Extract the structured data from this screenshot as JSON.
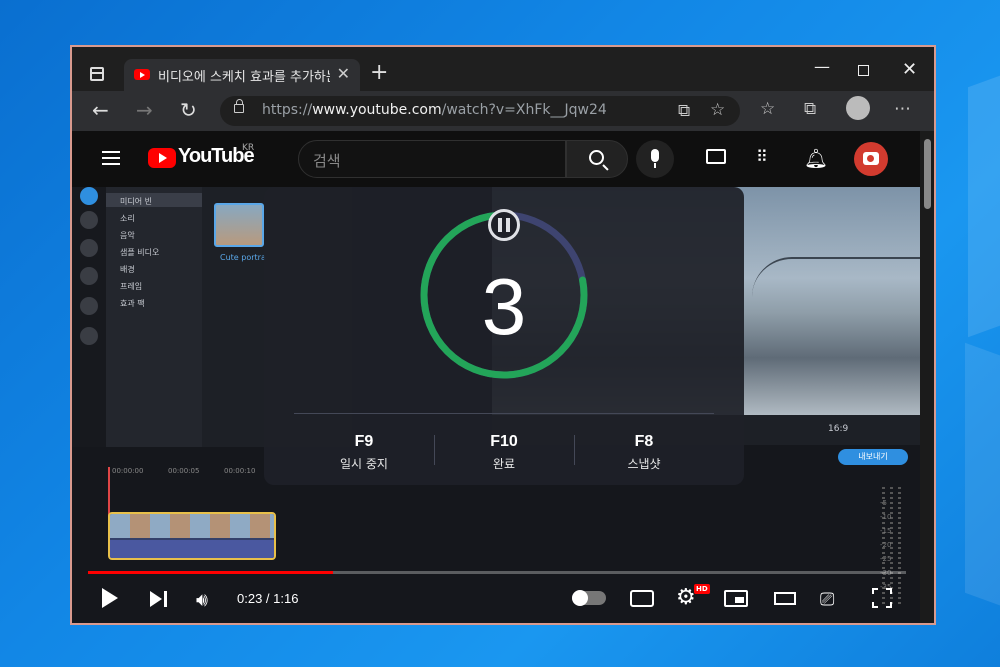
{
  "browser": {
    "tab_title": "비디오에 스케치 효과를 추가하는",
    "url_prefix": "https://",
    "url_domain": "www.youtube.com",
    "url_path": "/watch?v=XhFk__Jqw24"
  },
  "youtube": {
    "logo_text": "YouTube",
    "region": "KR",
    "search_placeholder": "검색"
  },
  "editor": {
    "menu_items": [
      "미디어 빈",
      "소리",
      "음악",
      "샘플 비디오",
      "배경",
      "프레임",
      "효과 팩"
    ],
    "media_thumb_label": "Cute portra",
    "aspect": "16:9",
    "export_label": "내보내기",
    "timeline_ticks": [
      "00:00:00",
      "00:00:05",
      "00:00:10"
    ],
    "vu_levels": [
      "-5",
      "-10",
      "-15",
      "-20",
      "-25",
      "-30",
      "-35"
    ]
  },
  "overlay": {
    "countdown": "3",
    "ring_progress": 0.78,
    "shortcuts": [
      {
        "key": "F9",
        "action": "일시 중지"
      },
      {
        "key": "F10",
        "action": "완료"
      },
      {
        "key": "F8",
        "action": "스냅샷"
      }
    ]
  },
  "player": {
    "time_text": "0:23 / 1:16",
    "progress_fraction": 0.3,
    "hd_badge": "HD"
  },
  "colors": {
    "ring_progress": "#23a559",
    "ring_track": "#3e4470",
    "yt_red": "#ff0000"
  }
}
